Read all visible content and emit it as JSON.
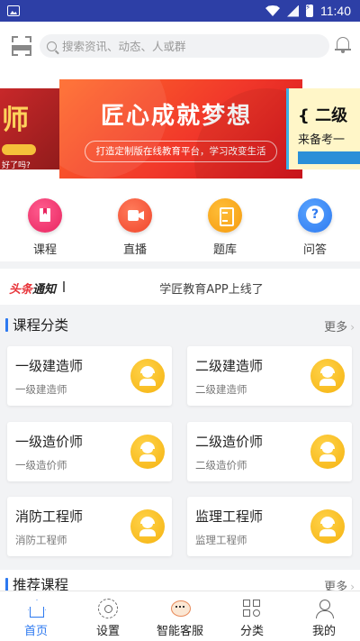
{
  "status_bar": {
    "time": "11:40",
    "icons": [
      "image-icon",
      "wifi-icon",
      "signal-icon",
      "battery-icon"
    ]
  },
  "search": {
    "placeholder": "搜索资讯、动态、人或群"
  },
  "banners": {
    "left_text": "师",
    "left_sub": "好了吗?",
    "main_title": "匠心成就梦想",
    "main_sub": "打造定制版在线教育平台，学习改变生活",
    "right_title": "{ 二级",
    "right_sub": "来备考一"
  },
  "quick_nav": [
    {
      "label": "课程",
      "icon": "book-icon"
    },
    {
      "label": "直播",
      "icon": "video-camera-icon"
    },
    {
      "label": "题库",
      "icon": "question-bank-icon"
    },
    {
      "label": "问答",
      "icon": "question-icon"
    }
  ],
  "notice": {
    "logo_a": "头条",
    "logo_b": "通知",
    "text": "学匠教育APP上线了"
  },
  "course_section": {
    "title": "课程分类",
    "more": "更多",
    "cards": [
      {
        "title": "一级建造师",
        "sub": "一级建造师"
      },
      {
        "title": "二级建造师",
        "sub": "二级建造师"
      },
      {
        "title": "一级造价师",
        "sub": "一级造价师"
      },
      {
        "title": "二级造价师",
        "sub": "二级造价师"
      },
      {
        "title": "消防工程师",
        "sub": "消防工程师"
      },
      {
        "title": "监理工程师",
        "sub": "监理工程师"
      }
    ]
  },
  "recommend_section": {
    "title": "推荐课程",
    "more": "更多"
  },
  "tabbar": [
    {
      "label": "首页",
      "icon": "home-icon",
      "active": true
    },
    {
      "label": "设置",
      "icon": "gear-icon"
    },
    {
      "label": "智能客服",
      "icon": "robot-icon"
    },
    {
      "label": "分类",
      "icon": "category-icon"
    },
    {
      "label": "我的",
      "icon": "user-icon"
    }
  ],
  "colors": {
    "status_bar": "#2d3fa6",
    "accent": "#2d79f0",
    "banner_red": "#f1382a",
    "card_icon": "#f5b20f"
  }
}
